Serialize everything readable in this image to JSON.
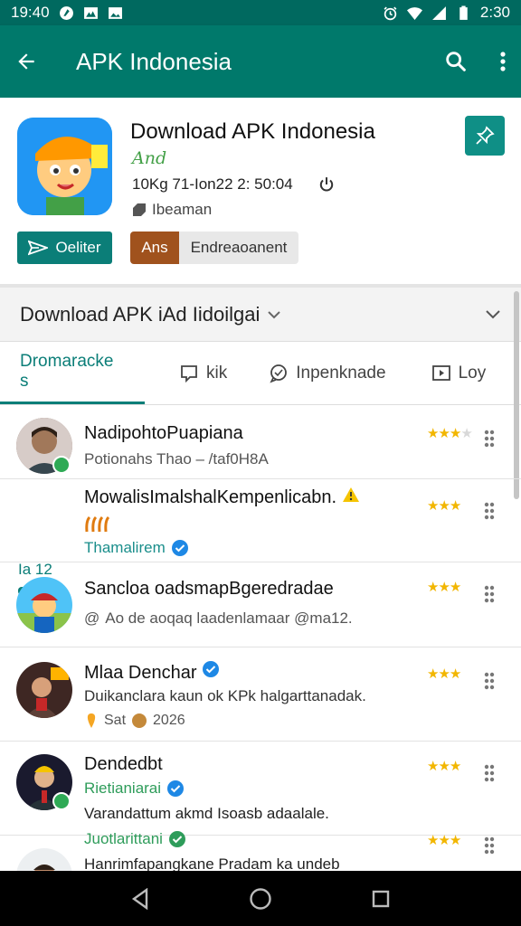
{
  "status_bar": {
    "time": "19:40",
    "clock": "2:30"
  },
  "app_bar": {
    "title": "APK Indonesia"
  },
  "app_info": {
    "title": "Download APK Indonesia",
    "subtitle": "And",
    "meta": "10Kg 71-Ion22 2: 50:04",
    "developer": "Ibeaman",
    "share_label": "Oeliter",
    "chip_primary": "Ans",
    "chip_secondary": "Endreaoanent"
  },
  "dropdown": {
    "label": "Download APK iAd Iidoilgai"
  },
  "tabs": [
    {
      "label": "Dromaracke s"
    },
    {
      "label": "kik"
    },
    {
      "label": "Inpenknade"
    },
    {
      "label": "Loy"
    }
  ],
  "items": [
    {
      "name": "NadipohtoPuapiana",
      "line2": "Potionahs Thao – /taf0H8A"
    },
    {
      "name": "MowalisImalshalKempenlicabn.",
      "progress_label": "Ia 12",
      "line2": "Thamalirem"
    },
    {
      "name": "Sancloa oadsmapBgeredradae",
      "line2": "Ao de aoqaq laadenlamaar @ma12."
    },
    {
      "name": "Mlaa Denchar",
      "line2": "Duikanclara kaun ok KPk halgarttanadak.",
      "date": "2026",
      "date_prefix": "Sat"
    },
    {
      "name": "Dendedbt",
      "line2": "Rietianiarai",
      "line3": "Varandattum akmd Isoasb adaalale."
    },
    {
      "name": "Juotlarittani",
      "line2": "Hanrimfapangkane Pradam ka undeb"
    }
  ],
  "colors": {
    "primary": "#00796b",
    "status": "#00695f",
    "accent": "#0b7e78",
    "star": "#f2b600"
  }
}
